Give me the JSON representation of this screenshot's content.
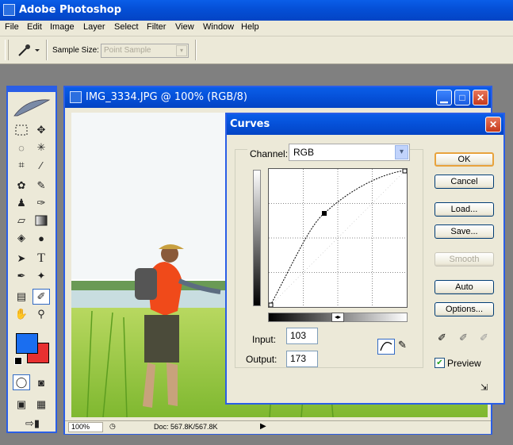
{
  "app": {
    "title": "Adobe Photoshop"
  },
  "menu": [
    "File",
    "Edit",
    "Image",
    "Layer",
    "Select",
    "Filter",
    "View",
    "Window",
    "Help"
  ],
  "options": {
    "sample_size_label": "Sample Size:",
    "sample_size_value": "Point Sample"
  },
  "document": {
    "title": "IMG_3334.JPG @ 100% (RGB/8)",
    "zoom": "100%",
    "doc_info": "Doc: 567.8K/567.8K"
  },
  "curves": {
    "title": "Curves",
    "channel_label": "Channel:",
    "channel_value": "RGB",
    "input_label": "Input:",
    "input_value": "103",
    "output_label": "Output:",
    "output_value": "173",
    "buttons": {
      "ok": "OK",
      "cancel": "Cancel",
      "load": "Load...",
      "save": "Save...",
      "smooth": "Smooth",
      "auto": "Auto",
      "options": "Options..."
    },
    "preview_label": "Preview",
    "preview_checked": true
  },
  "colors": {
    "foreground": "#1a6ef0",
    "background": "#e83030",
    "titlebar": "#0550d8"
  }
}
